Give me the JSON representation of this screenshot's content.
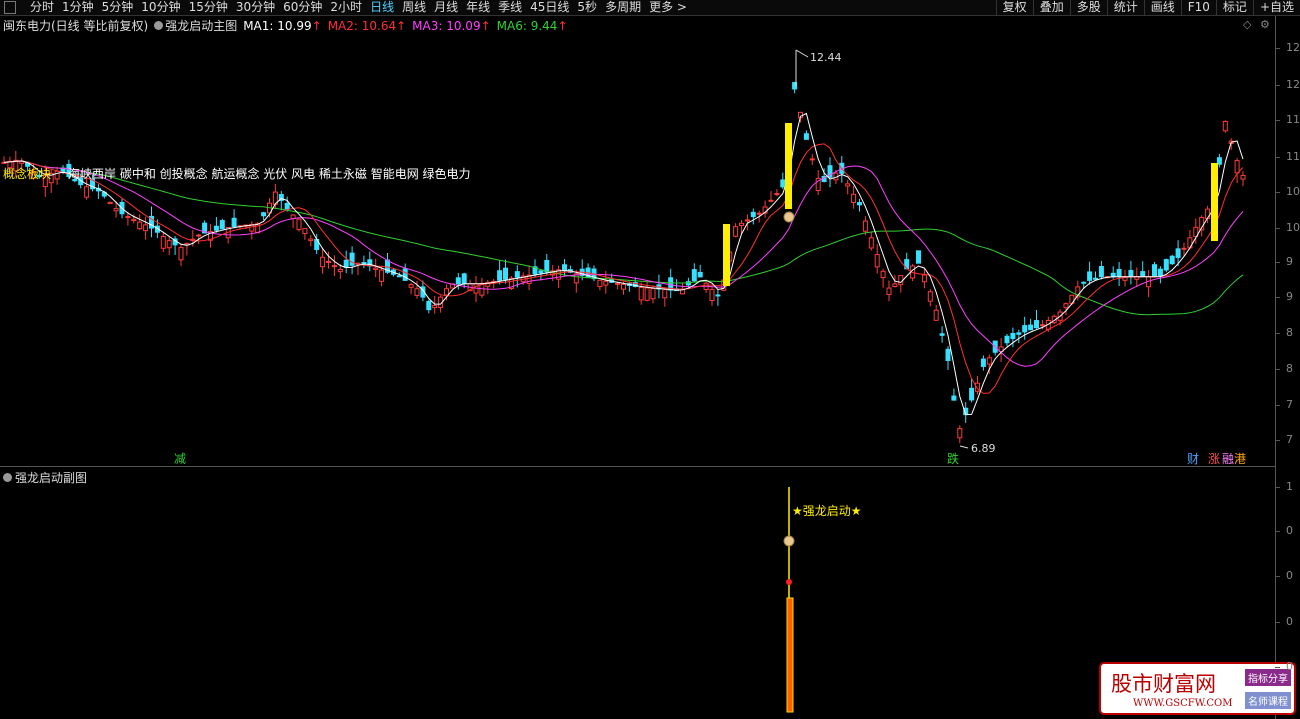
{
  "toolbar": {
    "tabs": [
      "分时",
      "1分钟",
      "5分钟",
      "10分钟",
      "15分钟",
      "30分钟",
      "60分钟",
      "2小时",
      "日线",
      "周线",
      "月线",
      "年线",
      "季线",
      "45日线",
      "5秒",
      "多周期",
      "更多 >"
    ],
    "active_tab": "日线",
    "right_buttons": [
      "复权",
      "叠加",
      "多股",
      "统计",
      "画线",
      "F10",
      "标记",
      "+自选"
    ]
  },
  "main_legend": {
    "stock": "闽东电力(日线 等比前复权)",
    "indicator": "强龙启动主图",
    "ma1": "MA1: 10.99",
    "ma2": "MA2: 10.64",
    "ma3": "MA3: 10.09",
    "ma6": "MA6: 9.44"
  },
  "concept": {
    "label": "概念板块",
    "text": "海峡西岸 碳中和 创投概念 航运概念 光伏 风电 稀土永磁 智能电网 绿色电力"
  },
  "price_labels": {
    "high": "12.44",
    "low": "6.89"
  },
  "markers": {
    "jian": "减",
    "die": "跌",
    "cai": "财",
    "zhang": "涨",
    "rong": "融",
    "gang": "港"
  },
  "sub_legend": {
    "name": "强龙启动副图",
    "signal": "★强龙启动★"
  },
  "axis_main": [
    "12",
    "12",
    "11",
    "11",
    "10",
    "10",
    "9",
    "9",
    "8",
    "8",
    "7",
    "7"
  ],
  "axis_sub": [
    "1",
    "0",
    "0",
    "0",
    "0"
  ],
  "watermark": {
    "title": "股市财富网",
    "tag1": "指标分享",
    "tag2": "名师课程",
    "url": "WWW.GSCFW.COM"
  },
  "colors": {
    "ma1": "#ffffff",
    "ma2": "#ff3030",
    "ma3": "#ff40ff",
    "ma6": "#30d030",
    "up": "#ff3a3a",
    "down": "#36e0ff",
    "signal": "#ffee00"
  }
}
